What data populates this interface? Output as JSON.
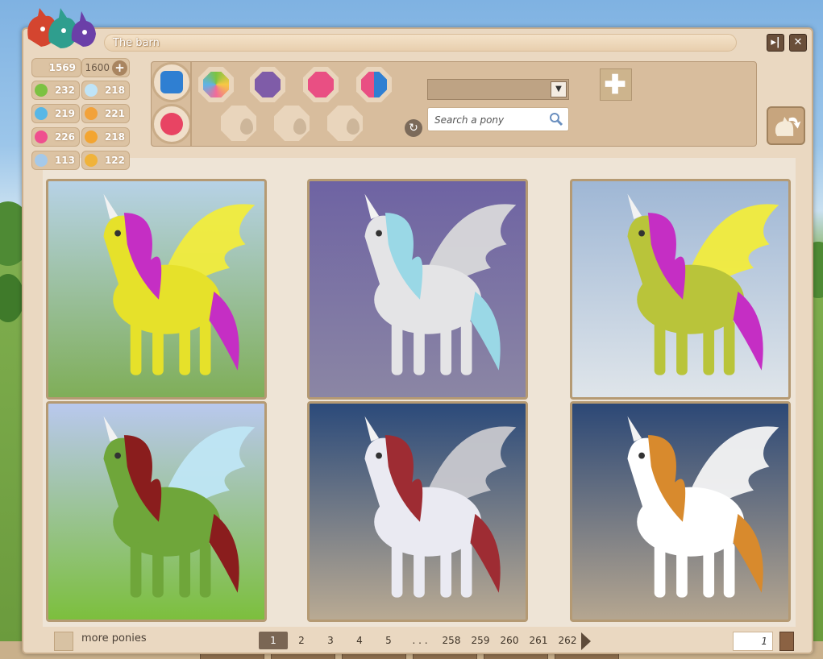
{
  "window": {
    "title": "The barn"
  },
  "resources": {
    "money": "1569",
    "pass": "1600",
    "stats": [
      {
        "icon": "apple-icon",
        "color": "#7cc242",
        "value": "232"
      },
      {
        "icon": "cloud-icon",
        "color": "#bfe4f7",
        "value": "218"
      },
      {
        "icon": "paw-icon",
        "color": "#58b7e6",
        "value": "219"
      },
      {
        "icon": "flame-icon",
        "color": "#f2a23a",
        "value": "221"
      },
      {
        "icon": "heart-icon",
        "color": "#ef4f8f",
        "value": "226"
      },
      {
        "icon": "hoof-icon",
        "color": "#f3a531",
        "value": "218"
      },
      {
        "icon": "feather-icon",
        "color": "#a5c9e9",
        "value": "113"
      },
      {
        "icon": "wing-icon",
        "color": "#f0b33a",
        "value": "122"
      }
    ]
  },
  "toolbar": {
    "search_placeholder": "Search a pony"
  },
  "ponies": [
    {
      "icon": "yellow-pegasus-pony",
      "bg": [
        "#b7d2e6",
        "#7fae58"
      ],
      "body": "#e6e12a",
      "mane": "#c52ec4",
      "wing": "#f1ec3c"
    },
    {
      "icon": "silver-pegasus-pony",
      "bg": [
        "#6e63a3",
        "#8b86a4"
      ],
      "body": "#e4e4e6",
      "mane": "#9ad8e6",
      "wing": "#d8d8da"
    },
    {
      "icon": "pony-with-stroller",
      "bg": [
        "#9fb7d5",
        "#dfe5ea"
      ],
      "body": "#b9c43a",
      "mane": "#c52ec4",
      "wing": "#f1ec3c"
    },
    {
      "icon": "green-unicorn-pony",
      "bg": [
        "#b9c8ee",
        "#7cbf3d"
      ],
      "body": "#6fa63a",
      "mane": "#8a1d1d",
      "wing": "#bfe6f4"
    },
    {
      "icon": "rearing-pegasus-pony",
      "bg": [
        "#2b4a7a",
        "#b9aa93"
      ],
      "body": "#eaeaf2",
      "mane": "#9e2c33",
      "wing": "#c8c8ce"
    },
    {
      "icon": "orange-pegasus-pony",
      "bg": [
        "#2c4876",
        "#b5a690"
      ],
      "body": "#ffffff",
      "mane": "#d88a2d",
      "wing": "#f4f4f4"
    }
  ],
  "footer": {
    "more_label": "more ponies",
    "pages": [
      "1",
      "2",
      "3",
      "4",
      "5",
      ". . .",
      "258",
      "259",
      "260",
      "261",
      "262"
    ],
    "current_page": "1",
    "page_input": "1"
  }
}
